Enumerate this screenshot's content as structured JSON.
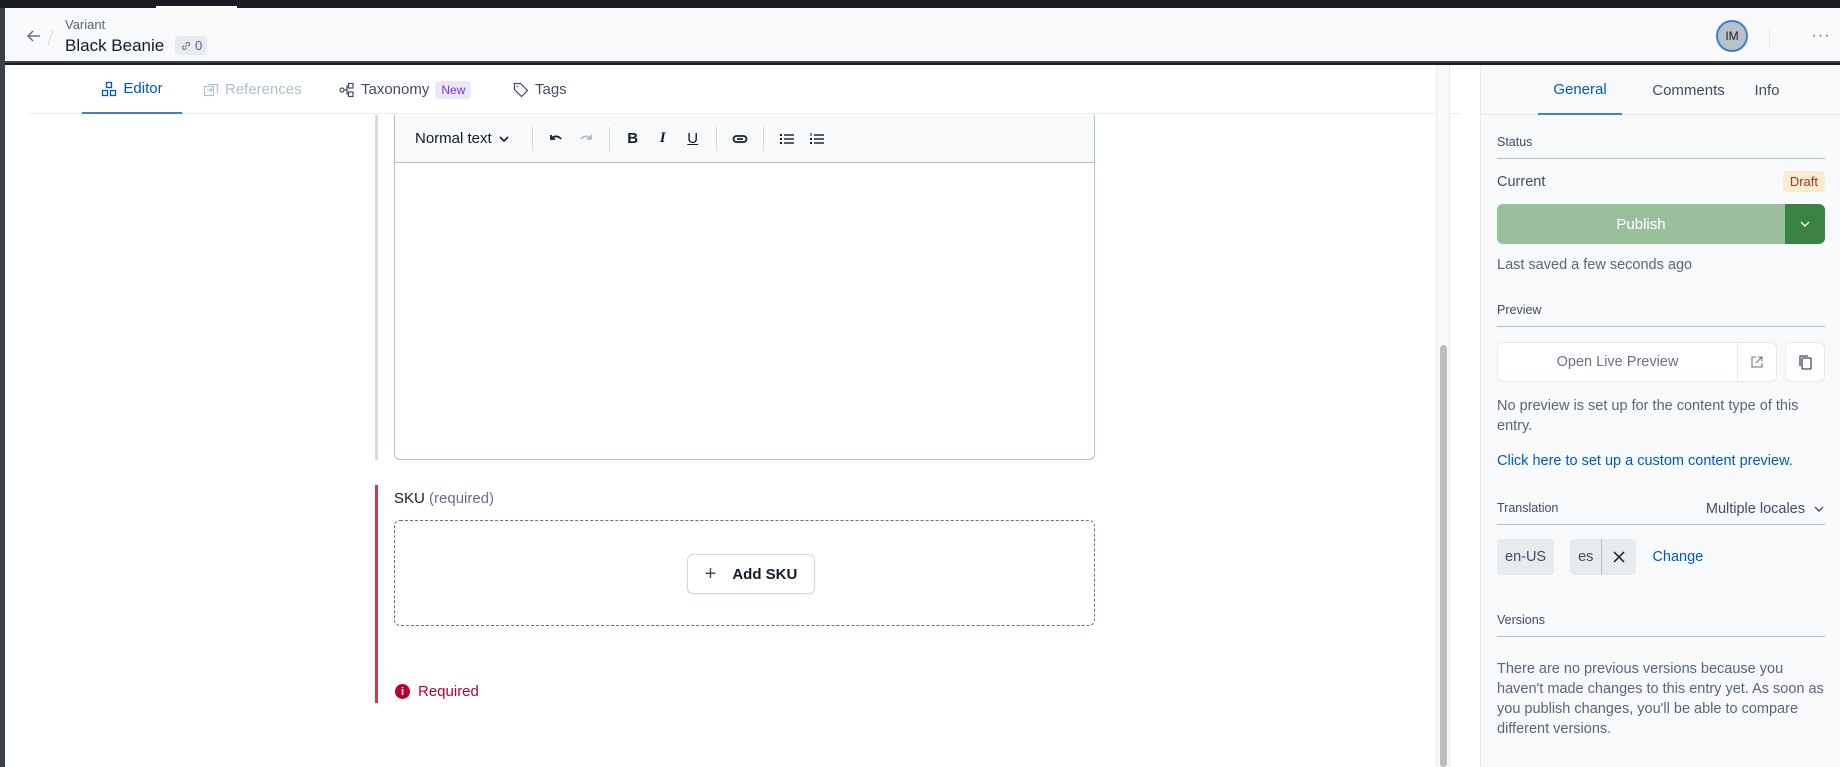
{
  "header": {
    "subtitle": "Variant",
    "title": "Black Beanie",
    "link_count": "0",
    "avatar_initials": "IM",
    "more_label": "···"
  },
  "tabs": [
    {
      "label": "Editor",
      "icon": "editor-icon",
      "state": "active"
    },
    {
      "label": "References",
      "icon": "references-icon",
      "state": "disabled"
    },
    {
      "label": "Taxonomy",
      "icon": "taxonomy-icon",
      "state": "normal",
      "badge": "New"
    },
    {
      "label": "Tags",
      "icon": "tag-icon",
      "state": "normal"
    }
  ],
  "editor": {
    "rich_text": {
      "format_dropdown": "Normal text",
      "toolbar": [
        "undo",
        "redo",
        "bold",
        "italic",
        "underline",
        "link",
        "bulleted-list",
        "numbered-list"
      ]
    },
    "sku": {
      "label": "SKU",
      "required_suffix": "(required)",
      "add_button": "Add SKU",
      "error": "Required"
    }
  },
  "sidebar": {
    "tabs": [
      {
        "label": "General",
        "active": true
      },
      {
        "label": "Comments",
        "active": false
      },
      {
        "label": "Info",
        "active": false
      }
    ],
    "status": {
      "heading": "Status",
      "current_label": "Current",
      "current_value": "Draft",
      "publish_label": "Publish",
      "last_saved": "Last saved a few seconds ago"
    },
    "preview": {
      "heading": "Preview",
      "open_button": "Open Live Preview",
      "note": "No preview is set up for the content type of this entry.",
      "setup_link": "Click here to set up a custom content preview."
    },
    "translation": {
      "heading": "Translation",
      "mode": "Multiple locales",
      "locales": [
        "en-US",
        "es"
      ],
      "change_link": "Change"
    },
    "versions": {
      "heading": "Versions",
      "note": "There are no previous versions because you haven't made changes to this entry yet. As soon as you publish changes, you'll be able to compare different versions."
    }
  },
  "colors": {
    "accent": "#0059c8",
    "error": "#bd002a",
    "publish": "#99bf9d",
    "publish_dark": "#3a8242",
    "draft_bg": "#fceccf",
    "draft_text": "#a8331f"
  }
}
